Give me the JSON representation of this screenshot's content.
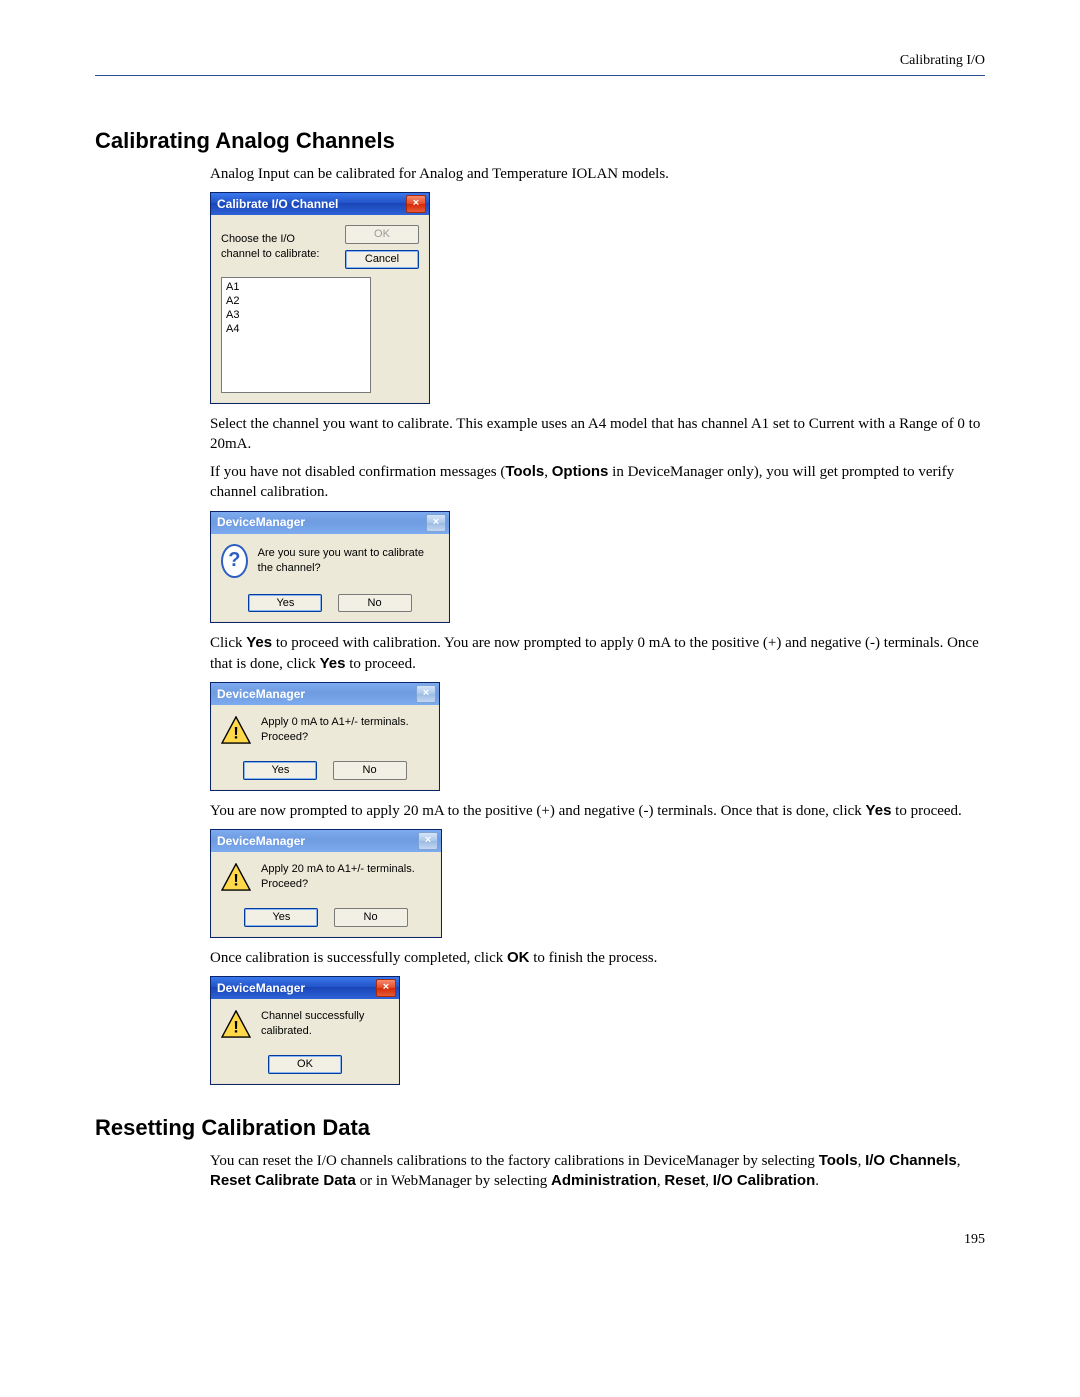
{
  "running_head": "Calibrating I/O",
  "page_number": "195",
  "heading1": "Calibrating Analog Channels",
  "heading2": "Resetting Calibration Data",
  "para1": "Analog Input can be calibrated for Analog and Temperature IOLAN models.",
  "para2": "Select the channel you want to calibrate. This example uses an A4 model that has channel A1 set to Current with a Range of 0 to 20mA.",
  "para3_a": "If you have not disabled confirmation messages (",
  "para3_b": "Tools",
  "para3_c": ", ",
  "para3_d": "Options",
  "para3_e": " in DeviceManager only), you will get prompted to verify channel calibration.",
  "para4_a": "Click ",
  "para4_b": "Yes",
  "para4_c": " to proceed with calibration. You are now prompted to apply 0 mA to the positive (+) and negative (-) terminals. Once that is done, click ",
  "para4_d": "Yes",
  "para4_e": " to proceed.",
  "para5_a": "You are now prompted to apply 20 mA to the positive (+) and negative (-) terminals. Once that is done, click ",
  "para5_b": "Yes",
  "para5_c": " to proceed.",
  "para6_a": "Once calibration is successfully completed, click ",
  "para6_b": "OK",
  "para6_c": " to finish the process.",
  "para7_a": "You can reset the I/O channels calibrations to the factory calibrations in DeviceManager by selecting ",
  "para7_b": "Tools",
  "para7_c": ", ",
  "para7_d": "I/O Channels",
  "para7_e": ", ",
  "para7_f": "Reset Calibrate Data",
  "para7_g": " or in WebManager by selecting ",
  "para7_h": "Administration",
  "para7_i": ", ",
  "para7_j": "Reset",
  "para7_k": ", ",
  "para7_l": "I/O Calibration",
  "para7_m": ".",
  "dlg1": {
    "title": "Calibrate I/O Channel",
    "prompt": "Choose the I/O channel to calibrate:",
    "ok": "OK",
    "cancel": "Cancel",
    "items": [
      "A1",
      "A2",
      "A3",
      "A4"
    ]
  },
  "dlg2": {
    "title": "DeviceManager",
    "msg": "Are you sure you want to calibrate the channel?",
    "yes": "Yes",
    "no": "No"
  },
  "dlg3": {
    "title": "DeviceManager",
    "msg": "Apply 0 mA to A1+/- terminals.  Proceed?",
    "yes": "Yes",
    "no": "No"
  },
  "dlg4": {
    "title": "DeviceManager",
    "msg": "Apply 20 mA to A1+/- terminals.  Proceed?",
    "yes": "Yes",
    "no": "No"
  },
  "dlg5": {
    "title": "DeviceManager",
    "msg": "Channel successfully calibrated.",
    "ok": "OK"
  }
}
